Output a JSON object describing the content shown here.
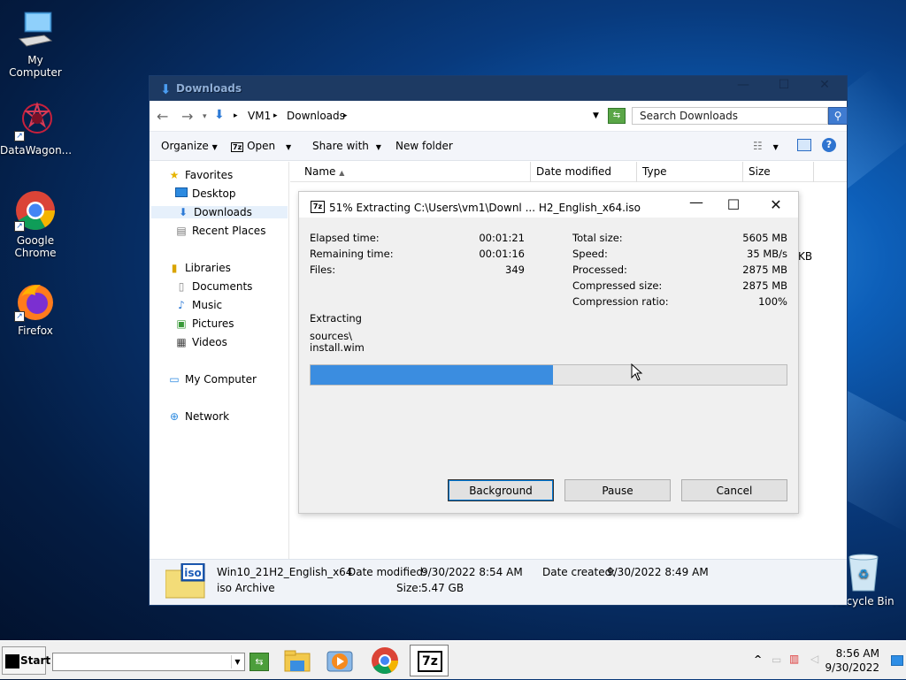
{
  "desktop": {
    "icons": [
      {
        "label": "My Computer"
      },
      {
        "label": "DataWagon..."
      },
      {
        "label": "Google Chrome"
      },
      {
        "label": "Firefox"
      },
      {
        "label": "Recycle Bin"
      }
    ]
  },
  "explorer": {
    "title": "Downloads",
    "window_controls": {
      "minimize": "—",
      "maximize": "☐",
      "close": "✕"
    },
    "address": {
      "crumb1": "VM1",
      "crumb2": "Downloads",
      "sep": "▸"
    },
    "search": {
      "placeholder": "Search Downloads"
    },
    "toolbar": {
      "organize": "Organize",
      "open": "Open",
      "share_with": "Share with",
      "new_folder": "New folder"
    },
    "sidebar": {
      "favorites": "Favorites",
      "desktop": "Desktop",
      "downloads": "Downloads",
      "recent_places": "Recent Places",
      "libraries": "Libraries",
      "documents": "Documents",
      "music": "Music",
      "pictures": "Pictures",
      "videos": "Videos",
      "my_computer": "My Computer",
      "network": "Network"
    },
    "columns": {
      "name": "Name",
      "date_modified": "Date modified",
      "type": "Type",
      "size": "Size"
    },
    "peek": {
      "size_fragment": "KB"
    },
    "details": {
      "filename": "Win10_21H2_English_x64",
      "filetype": "iso Archive",
      "date_modified_label": "Date modified:",
      "date_modified": "9/30/2022 8:54 AM",
      "date_created_label": "Date created:",
      "date_created": "9/30/2022 8:49 AM",
      "size_label": "Size:",
      "size": "5.47 GB",
      "icon_text": "iso"
    }
  },
  "dialog": {
    "title": "51% Extracting C:\\Users\\vm1\\Downl ... H2_English_x64.iso",
    "icon_text": "7z",
    "left": {
      "elapsed_label": "Elapsed time:",
      "elapsed": "00:01:21",
      "remaining_label": "Remaining time:",
      "remaining": "00:01:16",
      "files_label": "Files:",
      "files": "349"
    },
    "right": {
      "total_label": "Total size:",
      "total": "5605 MB",
      "speed_label": "Speed:",
      "speed": "35 MB/s",
      "processed_label": "Processed:",
      "processed": "2875 MB",
      "compressed_label": "Compressed size:",
      "compressed": "2875 MB",
      "ratio_label": "Compression ratio:",
      "ratio": "100%"
    },
    "extracting_label": "Extracting",
    "path_line1": "sources\\",
    "path_line2": "install.wim",
    "progress_fraction": 0.51,
    "buttons": {
      "background": "Background",
      "pause": "Pause",
      "cancel": "Cancel"
    }
  },
  "taskbar": {
    "start": "Start",
    "clock_time": "8:56 AM",
    "clock_date": "9/30/2022",
    "tray_chevron": "^",
    "apps": [
      "file-explorer",
      "media-player",
      "chrome",
      "7zip"
    ],
    "app_7z_label": "7z"
  },
  "colors": {
    "accent": "#3b8de0",
    "titlebar": "#1d3a63"
  }
}
